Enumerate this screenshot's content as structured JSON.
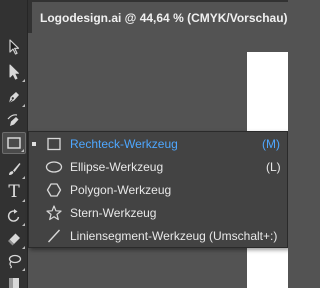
{
  "document_tab": {
    "title": "Logodesign.ai @ 44,64 % (CMYK/Vorschau)"
  },
  "toolbar": {
    "tools": [
      {
        "name": "selection-tool",
        "icon": "arrow-icon"
      },
      {
        "name": "direct-selection-tool",
        "icon": "white-arrow-icon"
      },
      {
        "name": "pen-tool",
        "icon": "pen-nib-icon"
      },
      {
        "name": "curvature-tool",
        "icon": "curvature-pen-icon"
      },
      {
        "name": "rectangle-tool",
        "icon": "rectangle-icon",
        "active": true
      },
      {
        "name": "paintbrush-tool",
        "icon": "brush-icon"
      },
      {
        "name": "type-tool",
        "icon": "type-t-icon"
      },
      {
        "name": "rotate-tool",
        "icon": "rotate-icon"
      },
      {
        "name": "eraser-tool",
        "icon": "eraser-icon"
      },
      {
        "name": "lasso-tool",
        "icon": "lasso-icon"
      },
      {
        "name": "swatch-tool",
        "icon": "swatch-icon"
      }
    ],
    "type_glyph": "T"
  },
  "flyout": {
    "items": [
      {
        "label": "Rechteck-Werkzeug",
        "shortcut": "(M)",
        "icon": "rectangle-icon",
        "selected": true
      },
      {
        "label": "Ellipse-Werkzeug",
        "shortcut": "(L)",
        "icon": "ellipse-icon",
        "selected": false
      },
      {
        "label": "Polygon-Werkzeug",
        "shortcut": "",
        "icon": "polygon-icon",
        "selected": false
      },
      {
        "label": "Stern-Werkzeug",
        "shortcut": "",
        "icon": "star-icon",
        "selected": false
      },
      {
        "label": "Liniensegment-Werkzeug",
        "shortcut": "(Umschalt+:)",
        "icon": "line-segment-icon",
        "selected": false
      }
    ]
  },
  "colors": {
    "workspace_bg": "#535353",
    "panel_bg": "#323232",
    "menu_bg": "#434343",
    "selected_text": "#4ea7ff",
    "text": "#e8e8e8",
    "artboard": "#ffffff"
  }
}
